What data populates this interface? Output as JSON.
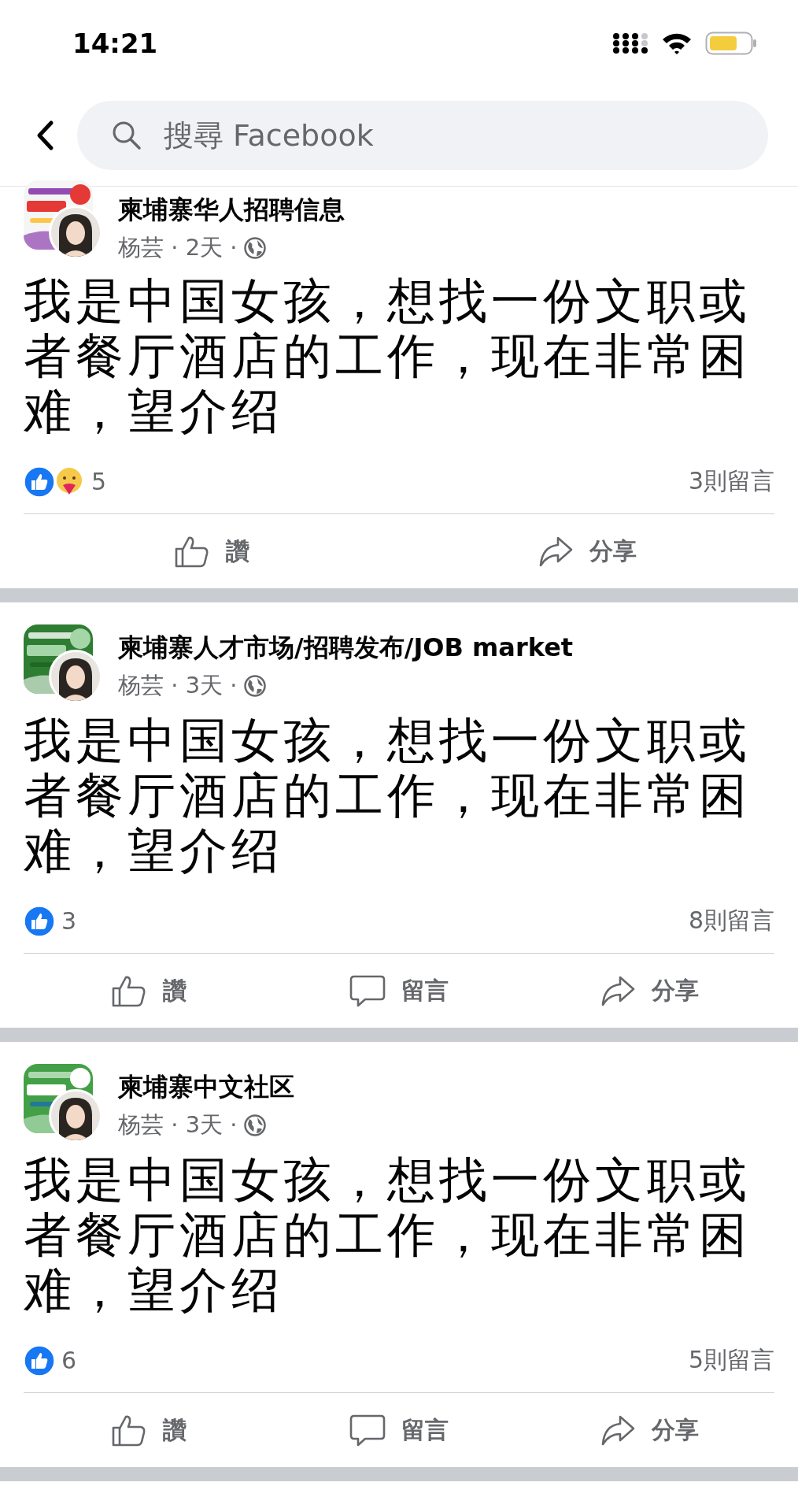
{
  "status_bar": {
    "time": "14:21"
  },
  "search": {
    "placeholder": "搜尋 Facebook"
  },
  "posts": [
    {
      "group": "柬埔寨华人招聘信息",
      "group_picture": {
        "kind": "picture"
      },
      "meta": "杨芸 · 2天 ·",
      "text": "我是中国女孩，想找一份文职或者餐厅酒店的工作，现在非常困难，望介绍",
      "reactions": [
        {
          "kind": "like"
        },
        {
          "kind": "care"
        }
      ],
      "reaction_count": "5",
      "comments": "3則留言",
      "actions": [
        {
          "kind": "like",
          "label": "讚"
        },
        {
          "kind": "share",
          "label": "分享"
        }
      ]
    },
    {
      "group": "柬埔寨人才市场/招聘发布/JOB market",
      "group_picture": {
        "kind": "picture"
      },
      "meta": "杨芸 · 3天 ·",
      "text": "我是中国女孩，想找一份文职或者餐厅酒店的工作，现在非常困难，望介绍",
      "reactions": [
        {
          "kind": "like"
        }
      ],
      "reaction_count": "3",
      "comments": "8則留言",
      "actions": [
        {
          "kind": "like",
          "label": "讚"
        },
        {
          "kind": "comment",
          "label": "留言"
        },
        {
          "kind": "share",
          "label": "分享"
        }
      ]
    },
    {
      "group": "柬埔寨中文社区",
      "group_picture": {
        "kind": "picture"
      },
      "meta": "杨芸 · 3天 ·",
      "text": "我是中国女孩，想找一份文职或者餐厅酒店的工作，现在非常困难，望介绍",
      "reactions": [
        {
          "kind": "like"
        }
      ],
      "reaction_count": "6",
      "comments": "5則留言",
      "actions": [
        {
          "kind": "like",
          "label": "讚"
        },
        {
          "kind": "comment",
          "label": "留言"
        },
        {
          "kind": "share",
          "label": "分享"
        }
      ]
    }
  ]
}
